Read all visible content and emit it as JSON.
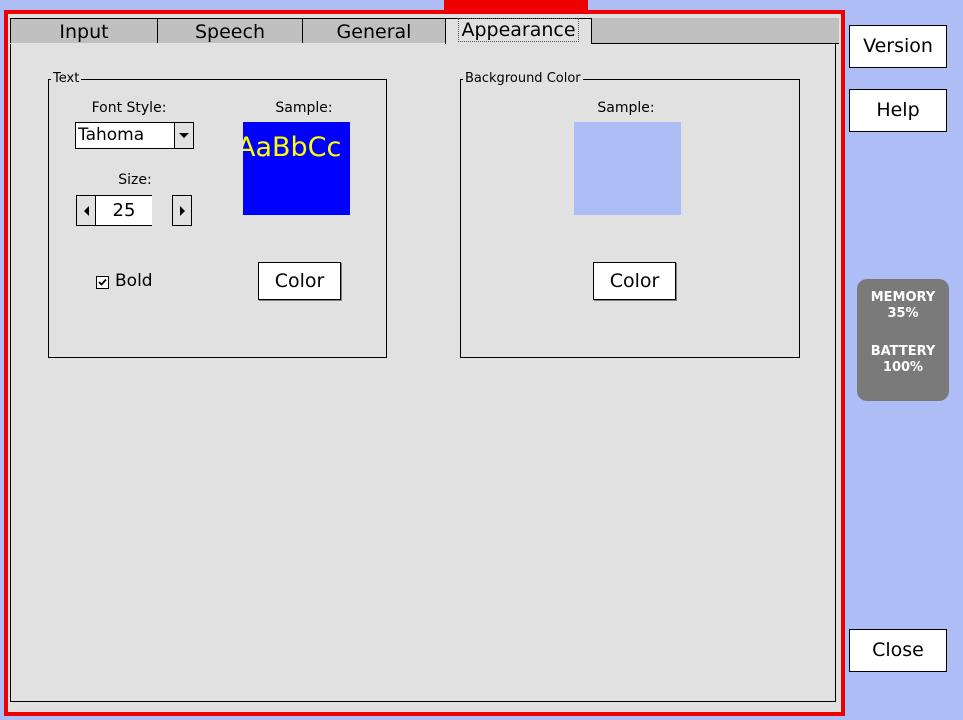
{
  "tabs": [
    {
      "label": "Input",
      "active": false
    },
    {
      "label": "Speech",
      "active": false
    },
    {
      "label": "General",
      "active": false
    },
    {
      "label": "Appearance",
      "active": true
    }
  ],
  "text_group": {
    "legend": "Text",
    "font_style_label": "Font Style:",
    "font_style_value": "Tahoma",
    "size_label": "Size:",
    "size_value": "25",
    "sample_label": "Sample:",
    "sample_text": "AaBbCc",
    "sample_text_color": "#ffff00",
    "sample_bg_color": "#0000ff",
    "bold_label": "Bold",
    "bold_checked": true,
    "color_button": "Color"
  },
  "background_group": {
    "legend": "Background Color",
    "sample_label": "Sample:",
    "sample_color": "#aebdf6",
    "color_button": "Color"
  },
  "side": {
    "version_label": "Version",
    "help_label": "Help",
    "close_label": "Close"
  },
  "status": {
    "memory_label": "MEMORY",
    "memory_value": "35%",
    "battery_label": "BATTERY",
    "battery_value": "100%"
  },
  "colors": {
    "frame_border": "#ee0000",
    "window_bg": "#e1e1e1",
    "desktop_bg": "#aebdf6",
    "status_bg": "#7a7a7a"
  },
  "icons": {
    "combo_arrow": "chevron-down-icon",
    "spin_left": "arrow-left-icon",
    "spin_right": "arrow-right-icon",
    "checkbox_mark": "check-icon"
  }
}
